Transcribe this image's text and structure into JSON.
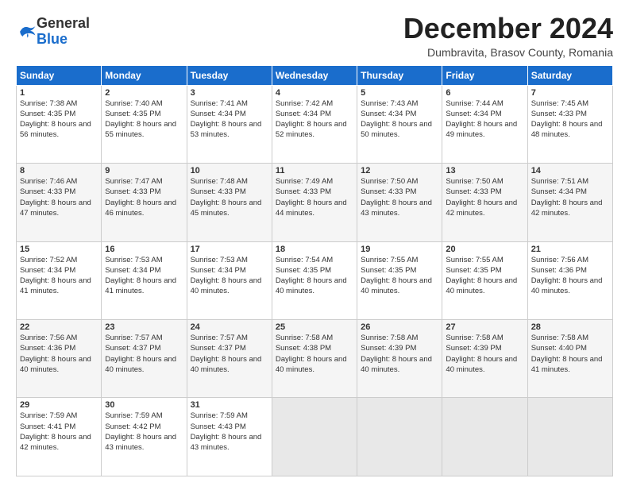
{
  "logo": {
    "general": "General",
    "blue": "Blue"
  },
  "title": "December 2024",
  "subtitle": "Dumbravita, Brasov County, Romania",
  "headers": [
    "Sunday",
    "Monday",
    "Tuesday",
    "Wednesday",
    "Thursday",
    "Friday",
    "Saturday"
  ],
  "weeks": [
    [
      {
        "day": "1",
        "rise": "7:38 AM",
        "set": "4:35 PM",
        "daylight": "8 hours and 56 minutes."
      },
      {
        "day": "2",
        "rise": "7:40 AM",
        "set": "4:35 PM",
        "daylight": "8 hours and 55 minutes."
      },
      {
        "day": "3",
        "rise": "7:41 AM",
        "set": "4:34 PM",
        "daylight": "8 hours and 53 minutes."
      },
      {
        "day": "4",
        "rise": "7:42 AM",
        "set": "4:34 PM",
        "daylight": "8 hours and 52 minutes."
      },
      {
        "day": "5",
        "rise": "7:43 AM",
        "set": "4:34 PM",
        "daylight": "8 hours and 50 minutes."
      },
      {
        "day": "6",
        "rise": "7:44 AM",
        "set": "4:34 PM",
        "daylight": "8 hours and 49 minutes."
      },
      {
        "day": "7",
        "rise": "7:45 AM",
        "set": "4:33 PM",
        "daylight": "8 hours and 48 minutes."
      }
    ],
    [
      {
        "day": "8",
        "rise": "7:46 AM",
        "set": "4:33 PM",
        "daylight": "8 hours and 47 minutes."
      },
      {
        "day": "9",
        "rise": "7:47 AM",
        "set": "4:33 PM",
        "daylight": "8 hours and 46 minutes."
      },
      {
        "day": "10",
        "rise": "7:48 AM",
        "set": "4:33 PM",
        "daylight": "8 hours and 45 minutes."
      },
      {
        "day": "11",
        "rise": "7:49 AM",
        "set": "4:33 PM",
        "daylight": "8 hours and 44 minutes."
      },
      {
        "day": "12",
        "rise": "7:50 AM",
        "set": "4:33 PM",
        "daylight": "8 hours and 43 minutes."
      },
      {
        "day": "13",
        "rise": "7:50 AM",
        "set": "4:33 PM",
        "daylight": "8 hours and 42 minutes."
      },
      {
        "day": "14",
        "rise": "7:51 AM",
        "set": "4:34 PM",
        "daylight": "8 hours and 42 minutes."
      }
    ],
    [
      {
        "day": "15",
        "rise": "7:52 AM",
        "set": "4:34 PM",
        "daylight": "8 hours and 41 minutes."
      },
      {
        "day": "16",
        "rise": "7:53 AM",
        "set": "4:34 PM",
        "daylight": "8 hours and 41 minutes."
      },
      {
        "day": "17",
        "rise": "7:53 AM",
        "set": "4:34 PM",
        "daylight": "8 hours and 40 minutes."
      },
      {
        "day": "18",
        "rise": "7:54 AM",
        "set": "4:35 PM",
        "daylight": "8 hours and 40 minutes."
      },
      {
        "day": "19",
        "rise": "7:55 AM",
        "set": "4:35 PM",
        "daylight": "8 hours and 40 minutes."
      },
      {
        "day": "20",
        "rise": "7:55 AM",
        "set": "4:35 PM",
        "daylight": "8 hours and 40 minutes."
      },
      {
        "day": "21",
        "rise": "7:56 AM",
        "set": "4:36 PM",
        "daylight": "8 hours and 40 minutes."
      }
    ],
    [
      {
        "day": "22",
        "rise": "7:56 AM",
        "set": "4:36 PM",
        "daylight": "8 hours and 40 minutes."
      },
      {
        "day": "23",
        "rise": "7:57 AM",
        "set": "4:37 PM",
        "daylight": "8 hours and 40 minutes."
      },
      {
        "day": "24",
        "rise": "7:57 AM",
        "set": "4:37 PM",
        "daylight": "8 hours and 40 minutes."
      },
      {
        "day": "25",
        "rise": "7:58 AM",
        "set": "4:38 PM",
        "daylight": "8 hours and 40 minutes."
      },
      {
        "day": "26",
        "rise": "7:58 AM",
        "set": "4:39 PM",
        "daylight": "8 hours and 40 minutes."
      },
      {
        "day": "27",
        "rise": "7:58 AM",
        "set": "4:39 PM",
        "daylight": "8 hours and 40 minutes."
      },
      {
        "day": "28",
        "rise": "7:58 AM",
        "set": "4:40 PM",
        "daylight": "8 hours and 41 minutes."
      }
    ],
    [
      {
        "day": "29",
        "rise": "7:59 AM",
        "set": "4:41 PM",
        "daylight": "8 hours and 42 minutes."
      },
      {
        "day": "30",
        "rise": "7:59 AM",
        "set": "4:42 PM",
        "daylight": "8 hours and 43 minutes."
      },
      {
        "day": "31",
        "rise": "7:59 AM",
        "set": "4:43 PM",
        "daylight": "8 hours and 43 minutes."
      },
      null,
      null,
      null,
      null
    ]
  ]
}
